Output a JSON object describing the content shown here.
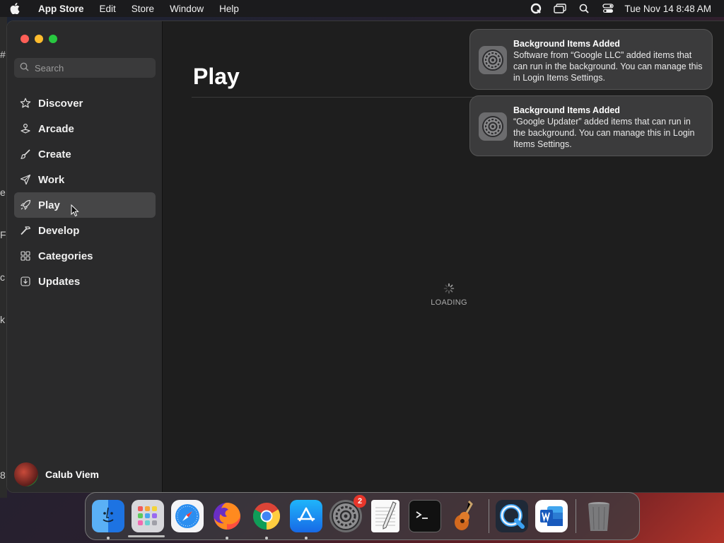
{
  "menubar": {
    "app_name": "App Store",
    "menus": [
      "Edit",
      "Store",
      "Window",
      "Help"
    ],
    "clock": "Tue Nov 14  8:48 AM"
  },
  "background_window_fragments": [
    "#",
    "e",
    "Fe",
    "c",
    "k",
    "8"
  ],
  "sidebar": {
    "search_placeholder": "Search",
    "items": [
      {
        "label": "Discover",
        "icon": "star-icon"
      },
      {
        "label": "Arcade",
        "icon": "joystick-icon"
      },
      {
        "label": "Create",
        "icon": "paintbrush-icon"
      },
      {
        "label": "Work",
        "icon": "paperplane-icon"
      },
      {
        "label": "Play",
        "icon": "rocket-icon",
        "active": true
      },
      {
        "label": "Develop",
        "icon": "hammer-icon"
      },
      {
        "label": "Categories",
        "icon": "grid-icon"
      },
      {
        "label": "Updates",
        "icon": "download-icon"
      }
    ],
    "user_name": "Calub Viem"
  },
  "main": {
    "title": "Play",
    "loading_text": "LOADING"
  },
  "notifications": [
    {
      "title": "Background Items Added",
      "body": "Software from “Google LLC” added items that can run in the background. You can manage this in Login Items Settings."
    },
    {
      "title": "Background Items Added",
      "body": "“Google Updater” added items that can run in the background. You can manage this in Login Items Settings."
    }
  ],
  "dock": {
    "apps": [
      "Finder",
      "Launchpad",
      "Safari",
      "Firefox",
      "Google Chrome",
      "App Store",
      "System Settings",
      "TextEdit",
      "Terminal",
      "GarageBand",
      "QuickTime",
      "Microsoft Word",
      "Trash"
    ],
    "system_settings_badge": "2"
  },
  "colors": {
    "accent_red": "#fe5f57",
    "accent_yellow": "#febc2e",
    "accent_green": "#28c840",
    "badge_red": "#e8362b"
  }
}
